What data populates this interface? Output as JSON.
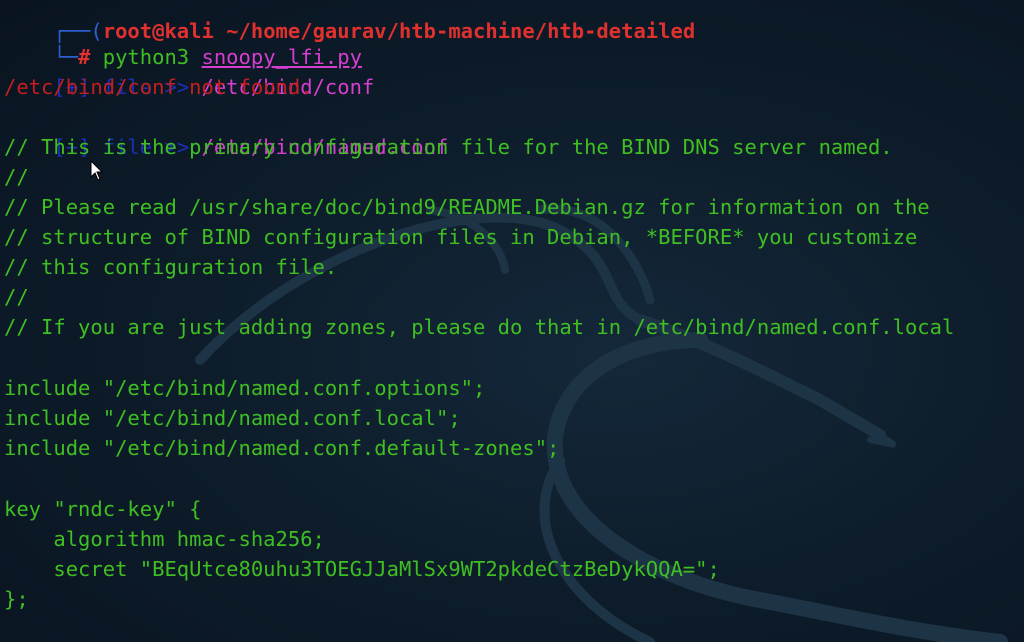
{
  "prompt": {
    "top_line_text": "root@kali ~/home/gaurav/htb-machine/htb-detailed",
    "hash": "#",
    "command": "python3",
    "script": "snoopy_lfi.py"
  },
  "lines": [
    {
      "prefix": "[+] file >> ",
      "path": "/etc/bind/conf"
    },
    {
      "error": "/etc/bind/conf not found."
    },
    {
      "prefix": "[+] file >> ",
      "path": "/etc/bind/named.conf"
    },
    {
      "text": "// This is the primary configuration file for the BIND DNS server named."
    },
    {
      "text": "//"
    },
    {
      "text": "// Please read /usr/share/doc/bind9/README.Debian.gz for information on the"
    },
    {
      "text": "// structure of BIND configuration files in Debian, *BEFORE* you customize"
    },
    {
      "text": "// this configuration file."
    },
    {
      "text": "//"
    },
    {
      "text": "// If you are just adding zones, please do that in /etc/bind/named.conf.local"
    },
    {
      "text": "include \"/etc/bind/named.conf.options\";"
    },
    {
      "text": "include \"/etc/bind/named.conf.local\";"
    },
    {
      "text": "include \"/etc/bind/named.conf.default-zones\";"
    },
    {
      "text": "key \"rndc-key\" {"
    },
    {
      "text": "    algorithm hmac-sha256;"
    },
    {
      "text": "    secret \"BEqUtce80uhu3TOEGJJaMlSx9WT2pkdeCtzBeDykQQA=\";"
    },
    {
      "text": "};"
    }
  ],
  "colors": {
    "background": "#0e1d2b",
    "output_green": "#3fbf22",
    "error_red": "#c41e1e",
    "path_magenta": "#d63ed0",
    "prefix_blue": "#1c2fb8"
  }
}
